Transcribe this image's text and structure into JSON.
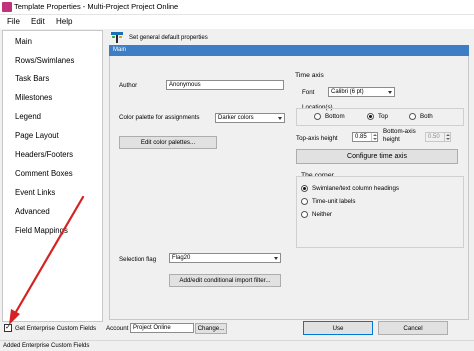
{
  "window": {
    "title": "Template Properties - Multi-Project Project Online"
  },
  "menu": {
    "file": "File",
    "edit": "Edit",
    "help": "Help"
  },
  "sidebar": {
    "items": [
      {
        "label": "Main"
      },
      {
        "label": "Rows/Swimlanes"
      },
      {
        "label": "Task Bars"
      },
      {
        "label": "Milestones"
      },
      {
        "label": "Legend"
      },
      {
        "label": "Page Layout"
      },
      {
        "label": "Headers/Footers"
      },
      {
        "label": "Comment Boxes"
      },
      {
        "label": "Event Links"
      },
      {
        "label": "Advanced"
      },
      {
        "label": "Field Mappings"
      }
    ]
  },
  "main": {
    "header_text": "Set general default properties",
    "bar_label": "Main",
    "author_label": "Author",
    "author_value": "Anonymous",
    "palette_label": "Color palette for assignments",
    "palette_value": "Darker colors",
    "edit_palettes_button": "Edit color palettes...",
    "selection_flag_label": "Selection flag",
    "selection_flag_value": "Flag20",
    "conditional_filter_button": "Add/edit conditional import filter..."
  },
  "time_axis": {
    "title": "Time axis",
    "font_label": "Font",
    "font_value": "Calibri (6 pt)",
    "location_label": "Location(s)",
    "bottom_label": "Bottom",
    "top_label": "Top",
    "both_label": "Both",
    "top_height_label": "Top-axis height",
    "top_height_value": "0.85",
    "bottom_height_label": "Bottom-axis height",
    "bottom_height_value": "0.50",
    "configure_button": "Configure time axis",
    "selected_location": "Top"
  },
  "corner": {
    "title": "The corner",
    "options": [
      {
        "label": "Swimlane/text column headings"
      },
      {
        "label": "Time-unit labels"
      },
      {
        "label": "Neither"
      }
    ],
    "selected": "Swimlane/text column headings"
  },
  "footer": {
    "checkbox_label": "Get Enterprise Custom Fields",
    "checkbox_checked": true,
    "account_label": "Account",
    "account_value": "Project Online",
    "change_button": "Change...",
    "use_button": "Use",
    "cancel_button": "Cancel"
  },
  "status": {
    "text": "Added Enterprise Custom Fields"
  },
  "colors": {
    "accent_bar": "#3d7ec4",
    "annotation_arrow": "#d62222",
    "selection_border": "#0078d7"
  }
}
